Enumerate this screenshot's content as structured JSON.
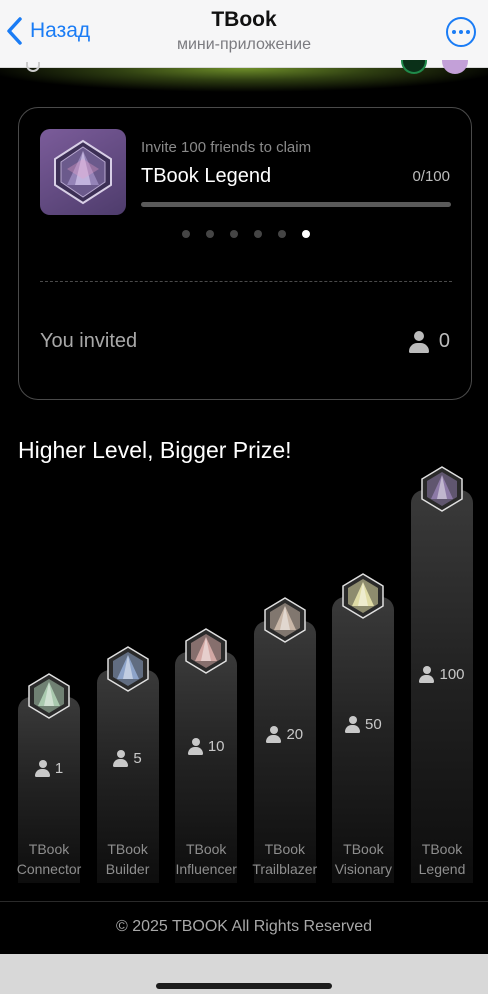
{
  "nav": {
    "back_label": "Назад",
    "title": "TBook",
    "subtitle": "мини-приложение"
  },
  "colors": {
    "accent": "#1a7cf5",
    "background": "#000000",
    "card_border": "#4a4a4a"
  },
  "invite_card": {
    "caption": "Invite 100 friends to claim",
    "badge_title": "TBook Legend",
    "progress_text": "0/100",
    "progress_fraction": 0,
    "carousel_pages": 6,
    "carousel_active": 5,
    "invited_label": "You invited",
    "invited_count": "0"
  },
  "section_title": "Higher Level, Bigger Prize!",
  "chart_data": {
    "type": "bar",
    "categories": [
      "TBook Connector",
      "TBook Builder",
      "TBook Influencer",
      "TBook Trailblazer",
      "TBook Visionary",
      "TBook Legend"
    ],
    "values": [
      1,
      5,
      10,
      20,
      50,
      100
    ],
    "labels": [
      "1",
      "5",
      "10",
      "20",
      "50",
      "100"
    ],
    "name_lines": [
      [
        "TBook",
        "Connector"
      ],
      [
        "TBook",
        "Builder"
      ],
      [
        "TBook",
        "Influencer"
      ],
      [
        "TBook",
        "Trailblazer"
      ],
      [
        "TBook",
        "Visionary"
      ],
      [
        "TBook",
        "Legend"
      ]
    ],
    "badge_colors": [
      "#a9c9ae",
      "#8ea4c9",
      "#d2a8a4",
      "#c9b7a8",
      "#e0dca6",
      "#8d7aa7"
    ],
    "title": "",
    "xlabel": "",
    "ylabel": "",
    "grid": false
  },
  "footer": "© 2025 TBOOK All Rights Reserved"
}
